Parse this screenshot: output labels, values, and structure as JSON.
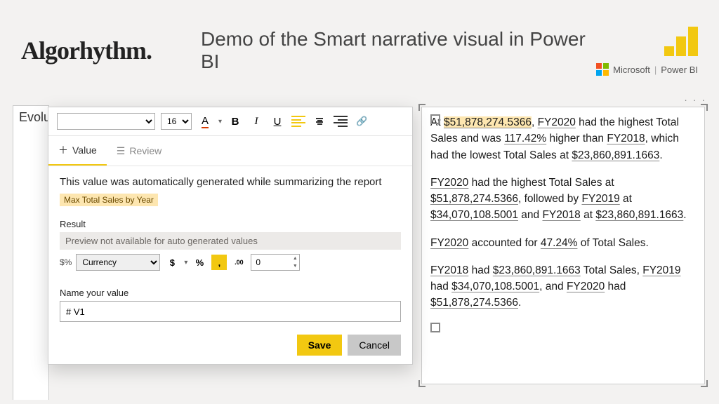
{
  "header": {
    "logo": "Algorhythm.",
    "title": "Demo of the Smart narrative visual in Power BI",
    "microsoft": "Microsoft",
    "product": "Power BI"
  },
  "visual_title_partial": "Evolut",
  "toolbar": {
    "font_size": "16",
    "font_color_label": "A",
    "bold": "B",
    "italic": "I",
    "underline": "U"
  },
  "tabs": {
    "value": "Value",
    "review": "Review"
  },
  "panel": {
    "message": "This value was automatically generated while summarizing the report",
    "tag": "Max Total Sales by Year",
    "result_label": "Result",
    "preview_text": "Preview not available for auto generated values",
    "format_type": "Currency",
    "dollar": "$",
    "percent": "%",
    "comma": ",",
    "dec_decrease": ".00",
    "decimals": "0",
    "name_label": "Name your value",
    "name_value": "# V1",
    "save": "Save",
    "cancel": "Cancel"
  },
  "more": "· · ·",
  "narrative": {
    "p1": {
      "t0": "At ",
      "v0": "$51,878,274.5366",
      "t1": ", ",
      "v1": "FY2020",
      "t2": " had the highest Total Sales and was ",
      "v2": "117.42%",
      "t3": " higher than ",
      "v3": "FY2018",
      "t4": ", which had the lowest Total Sales at ",
      "v4": "$23,860,891.1663",
      "t5": "."
    },
    "p2": {
      "v0": "FY2020",
      "t0": " had the highest Total Sales at ",
      "v1": "$51,878,274.5366",
      "t1": ", followed by ",
      "v2": "FY2019",
      "t2": " at ",
      "v3": "$34,070,108.5001",
      "t3": " and ",
      "v4": "FY2018",
      "t4": " at ",
      "v5": "$23,860,891.1663",
      "t5": "."
    },
    "p3": {
      "v0": "FY2020",
      "t0": " accounted for ",
      "v1": "47.24%",
      "t1": " of Total Sales."
    },
    "p4": {
      "v0": "FY2018",
      "t0": " had ",
      "v1": "$23,860,891.1663",
      "t1": " Total Sales, ",
      "v2": "FY2019",
      "t2": " had ",
      "v3": "$34,070,108.5001",
      "t3": ", and ",
      "v4": "FY2020",
      "t4": " had ",
      "v5": "$51,878,274.5366",
      "t5": "."
    }
  }
}
